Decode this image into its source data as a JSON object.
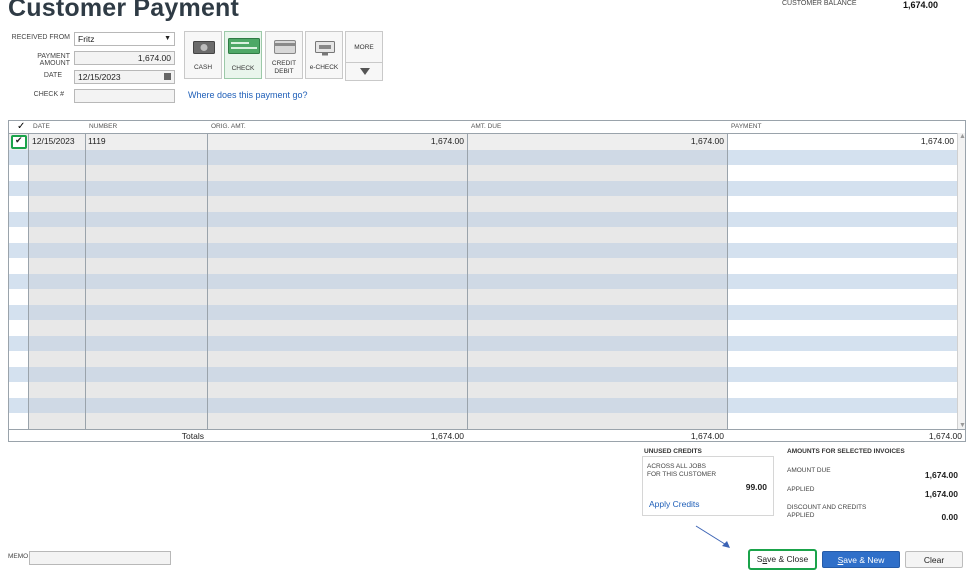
{
  "page": {
    "title": "Customer Payment"
  },
  "customer_balance": {
    "label": "CUSTOMER BALANCE",
    "value": "1,674.00"
  },
  "form": {
    "received_from": {
      "label": "RECEIVED FROM",
      "value": "Fritz"
    },
    "payment_amount": {
      "label": "PAYMENT AMOUNT",
      "value": "1,674.00"
    },
    "date": {
      "label": "DATE",
      "value": "12/15/2023"
    },
    "check_no": {
      "label": "CHECK #",
      "value": ""
    }
  },
  "payment_methods": [
    {
      "label": "CASH",
      "icon": "cash-icon"
    },
    {
      "label": "CHECK",
      "icon": "check-icon"
    },
    {
      "label_line1": "CREDIT",
      "label_line2": "DEBIT",
      "icon": "credit-card-icon"
    },
    {
      "label": "e-CHECK",
      "icon": "echeck-icon"
    },
    {
      "label": "MORE",
      "icon": "chevron-down-icon"
    }
  ],
  "where_link": "Where does this payment go?",
  "table": {
    "columns": {
      "check": "✓",
      "date": "DATE",
      "number": "NUMBER",
      "orig_amt": "ORIG. AMT.",
      "amt_due": "AMT. DUE",
      "payment": "PAYMENT"
    },
    "rows": [
      {
        "checked": true,
        "date": "12/15/2023",
        "number": "1119",
        "orig_amt": "1,674.00",
        "amt_due": "1,674.00",
        "payment": "1,674.00"
      }
    ],
    "totals": {
      "label": "Totals",
      "orig_amt": "1,674.00",
      "amt_due": "1,674.00",
      "payment": "1,674.00"
    }
  },
  "unused_credits": {
    "title": "UNUSED CREDITS",
    "line1": "ACROSS ALL JOBS",
    "line2": "FOR THIS CUSTOMER",
    "value": "99.00",
    "link": "Apply Credits"
  },
  "amounts": {
    "title": "AMOUNTS FOR SELECTED INVOICES",
    "amount_due_label": "AMOUNT DUE",
    "amount_due": "1,674.00",
    "applied_label": "APPLIED",
    "applied": "1,674.00",
    "discount_line1": "DISCOUNT AND CREDITS",
    "discount_line2": "APPLIED",
    "discount": "0.00"
  },
  "memo": {
    "label": "MEMO",
    "value": ""
  },
  "buttons": {
    "save_close_pre": "S",
    "save_close_u": "a",
    "save_close_post": "ve & Close",
    "save_new_pre": "",
    "save_new_u": "S",
    "save_new_post": "ave & New",
    "clear": "Clear"
  },
  "colors": {
    "highlight": "#1aa34a",
    "row_blue": "#d4e1ef",
    "row_white": "#ffffff",
    "primary": "#2f6fc9"
  }
}
